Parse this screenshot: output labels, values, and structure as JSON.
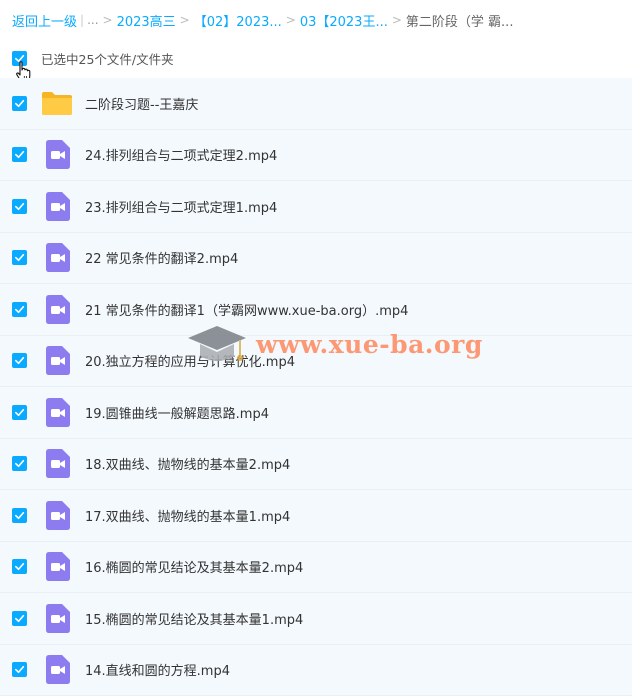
{
  "breadcrumb": {
    "back_label": "返回上一级",
    "ellipsis": "...",
    "items": [
      {
        "label": "2023高三"
      },
      {
        "label": "【02】2023..."
      },
      {
        "label": "03【2023王..."
      }
    ],
    "current": "第二阶段（学 霸..."
  },
  "selection": {
    "text": "已选中25个文件/文件夹",
    "checked": true
  },
  "files": [
    {
      "name": "二阶段习题--王嘉庆",
      "type": "folder",
      "checked": true
    },
    {
      "name": "24.排列组合与二项式定理2.mp4",
      "type": "video",
      "checked": true
    },
    {
      "name": "23.排列组合与二项式定理1.mp4",
      "type": "video",
      "checked": true
    },
    {
      "name": "22 常见条件的翻译2.mp4",
      "type": "video",
      "checked": true
    },
    {
      "name": "21 常见条件的翻译1（学霸网www.xue-ba.org）.mp4",
      "type": "video",
      "checked": true
    },
    {
      "name": "20.独立方程的应用与计算优化.mp4",
      "type": "video",
      "checked": true
    },
    {
      "name": "19.圆锥曲线一般解题思路.mp4",
      "type": "video",
      "checked": true
    },
    {
      "name": "18.双曲线、抛物线的基本量2.mp4",
      "type": "video",
      "checked": true
    },
    {
      "name": "17.双曲线、抛物线的基本量1.mp4",
      "type": "video",
      "checked": true
    },
    {
      "name": "16.椭圆的常见结论及其基本量2.mp4",
      "type": "video",
      "checked": true
    },
    {
      "name": "15.椭圆的常见结论及其基本量1.mp4",
      "type": "video",
      "checked": true
    },
    {
      "name": "14.直线和圆的方程.mp4",
      "type": "video",
      "checked": true
    }
  ],
  "watermark": {
    "text": "www.xue-ba.org",
    "icon": "graduation-cap-icon"
  },
  "colors": {
    "accent": "#09aaff",
    "video_icon": "#8c7cf0",
    "folder": "#ffc83d",
    "row_bg": "#f4f9fd"
  }
}
